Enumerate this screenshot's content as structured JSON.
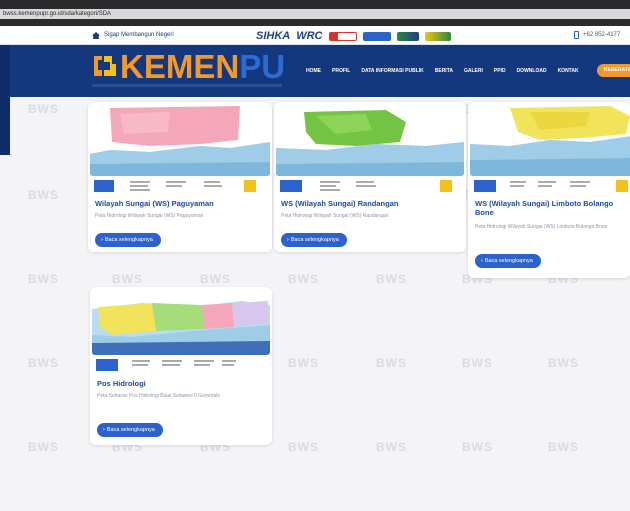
{
  "browser": {
    "url": "bwss.kemenpupr.go.id/sda/kategori/SDA"
  },
  "topbar": {
    "tagline": "Sigap Membangun Negeri",
    "sponsors": [
      "SIHKA",
      "WRC"
    ],
    "phone": "+62 852-4177"
  },
  "header": {
    "logo_main": "KEMEN",
    "logo_accent": "PU",
    "nav": [
      "HOME",
      "PROFIL",
      "DATA INFORMASI PUBLIK",
      "BERITA",
      "GALERI",
      "PPID",
      "DOWNLOAD",
      "KONTAK"
    ],
    "login_label": "KEBERATAN"
  },
  "watermark": "BWS",
  "cards": [
    {
      "title": "Wilayah Sungai (WS) Paguyaman",
      "desc": "Peta Hidrologi Wilayah Sungai (WS) Paguyaman",
      "button": "Baca selengkapnya"
    },
    {
      "title": "WS (Wilayah Sungai) Randangan",
      "desc": "Peta Hidrologi Wilayah Sungai (WS) Randangan",
      "button": "Baca selengkapnya"
    },
    {
      "title": "WS (Wilayah Sungai) Limboto Bolango Bone",
      "desc": "Peta Hidrologi Wilayah Sungai (WS) Limboto Bolango Bone",
      "button": "Baca selengkapnya"
    },
    {
      "title": "Pos Hidrologi",
      "desc": "Peta Sebaran Pos Hidrologi Balai Sulawesi II Gorontalo",
      "button": "Baca selengkapnya"
    }
  ],
  "colors": {
    "header": "#14387e",
    "accent": "#f2992a",
    "button": "#2c62cb",
    "title": "#1d4aa0"
  }
}
